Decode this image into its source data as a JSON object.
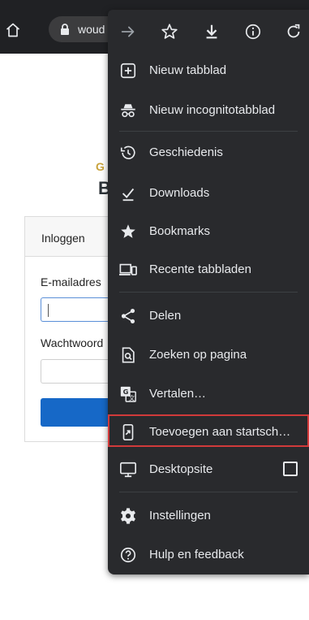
{
  "browser": {
    "url_text": "woud",
    "icons": {
      "home": "home-icon",
      "lock": "lock-icon"
    }
  },
  "page": {
    "logo_top": "G",
    "logo_bottom": "B",
    "card_title": "Inloggen",
    "email_label": "E-mailadres",
    "password_label": "Wachtwoord",
    "email_value": "",
    "password_value": ""
  },
  "menu": {
    "toolbar_icons": [
      "forward-icon",
      "star-icon",
      "download-icon",
      "info-icon",
      "refresh-icon"
    ],
    "items": [
      {
        "label": "Nieuw tabblad",
        "icon": "new-tab-icon"
      },
      {
        "label": "Nieuw incognitotabblad",
        "icon": "incognito-icon"
      },
      {
        "label": "Geschiedenis",
        "icon": "history-icon"
      },
      {
        "label": "Downloads",
        "icon": "downloads-icon"
      },
      {
        "label": "Bookmarks",
        "icon": "bookmarks-icon"
      },
      {
        "label": "Recente tabbladen",
        "icon": "recent-tabs-icon"
      },
      {
        "label": "Delen",
        "icon": "share-icon"
      },
      {
        "label": "Zoeken op pagina",
        "icon": "find-in-page-icon"
      },
      {
        "label": "Vertalen…",
        "icon": "translate-icon"
      },
      {
        "label": "Toevoegen aan startsch…",
        "icon": "add-to-home-icon"
      },
      {
        "label": "Desktopsite",
        "icon": "desktop-icon"
      },
      {
        "label": "Instellingen",
        "icon": "settings-icon"
      },
      {
        "label": "Hulp en feedback",
        "icon": "help-icon"
      }
    ],
    "desktop_site_checked": false,
    "highlighted_item": "Toevoegen aan startsch…"
  },
  "colors": {
    "toolbar_bg": "#202124",
    "menu_bg": "#292a2d",
    "menu_text": "#e8eaed",
    "highlight": "#d13a3a",
    "login_button": "#1668c7"
  }
}
